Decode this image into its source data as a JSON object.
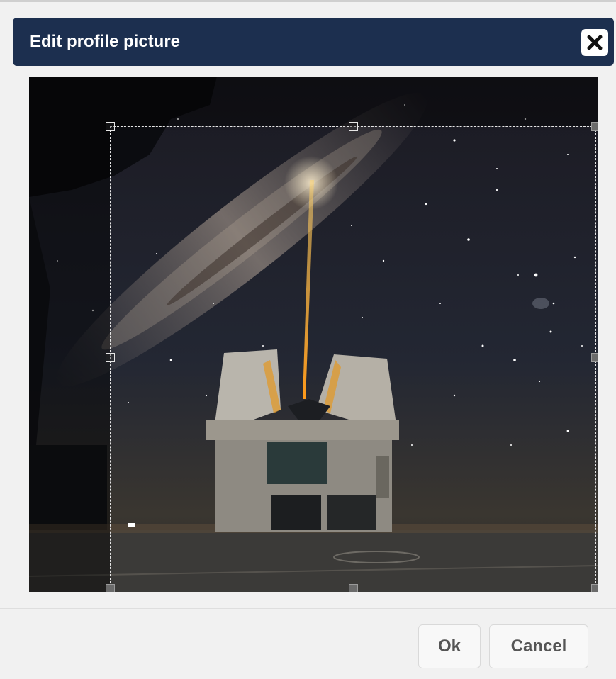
{
  "dialog": {
    "title": "Edit profile picture",
    "close_icon": "close-icon"
  },
  "cropper": {
    "image_subject": "Milky Way night sky above an observatory telescope dome emitting a laser beam",
    "handles": [
      "top-left",
      "top-center",
      "top-right",
      "middle-left",
      "middle-right",
      "bottom-left",
      "bottom-center",
      "bottom-right"
    ]
  },
  "footer": {
    "ok_label": "Ok",
    "cancel_label": "Cancel"
  },
  "colors": {
    "header_background": "#1c2f4f",
    "dialog_background": "#f1f1f1",
    "button_text": "#555555"
  }
}
